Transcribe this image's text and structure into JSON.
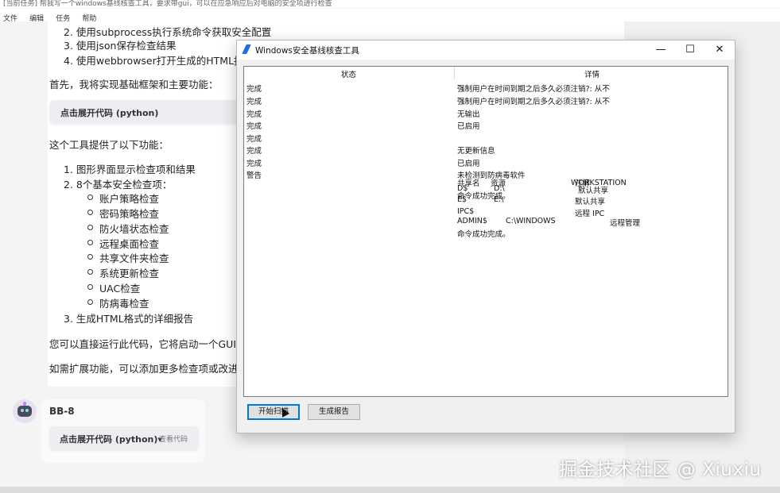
{
  "app_window": {
    "title": "[当前任务] 帮我写一个windows基线核查工具，要求带gui，可以在应急响应后对电脑的安全项进行检查"
  },
  "menu": [
    "文件",
    "编辑",
    "任务",
    "帮助"
  ],
  "chat": {
    "plan_items": [
      "2. 使用subprocess执行系统命令获取安全配置",
      "3. 使用json保存检查结果",
      "4. 使用webbrowser打开生成的HTML报告"
    ],
    "intro": "首先，我将实现基础框架和主要功能：",
    "code_toggle_1": "点击展开代码 (python)",
    "features_intro": "这个工具提供了以下功能：",
    "feature_1": "1. 图形界面显示检查项和结果",
    "feature_2": "2. 8个基本安全检查项：",
    "checks": [
      "账户策略检查",
      "密码策略检查",
      "防火墙状态检查",
      "远程桌面检查",
      "共享文件夹检查",
      "系统更新检查",
      "UAC检查",
      "防病毒检查"
    ],
    "feature_3": "3. 生成HTML格式的详细报告",
    "run_note": "您可以直接运行此代码，它将启动一个GUI",
    "extend_note": "如需扩展功能，可以添加更多检查项或改进"
  },
  "bb8": {
    "name": "BB-8",
    "code_toggle": "点击展开代码 (python)▾",
    "view_code": "查看代码"
  },
  "dialog": {
    "title": "Windows安全基线核查工具",
    "controls": {
      "minimize": "—",
      "maximize": "☐",
      "close": "✕"
    },
    "columns": {
      "status": "状态",
      "details": "详情"
    },
    "rows": [
      {
        "status": "完成",
        "detail": "强制用户在时间到期之后多久必须注销?:    从不"
      },
      {
        "status": "完成",
        "detail": "强制用户在时间到期之后多久必须注销?:    从不"
      },
      {
        "status": "完成",
        "detail": "无输出"
      },
      {
        "status": "完成",
        "detail": "已启用"
      },
      {
        "status": "完成",
        "detail": ""
      },
      {
        "status": "完成",
        "detail": "无更新信息"
      },
      {
        "status": "完成",
        "detail": "已启用"
      },
      {
        "status": "警告",
        "detail": "未检测到防病毒软件"
      }
    ],
    "share_lines": [
      {
        "name": "共享名",
        "path": "资源",
        "remark": "注解"
      },
      {
        "name": "D$",
        "path": "D:\\",
        "remark": "默认共享"
      },
      {
        "name": "E$",
        "path": "E:\\",
        "remark": "默认共享"
      },
      {
        "name": "IPC$",
        "path": "",
        "remark": "远程 IPC"
      },
      {
        "name": "ADMIN$",
        "path": "C:\\WINDOWS",
        "remark": "远程管理"
      }
    ],
    "overlap_workstation": "WORKSTATION",
    "overlap_success": "命令成功完成。",
    "final_line": "命令成功完成。",
    "buttons": {
      "scan": "开始扫描",
      "report": "生成报告"
    }
  },
  "watermark": "掘金技术社区 @ Xiuxiu"
}
